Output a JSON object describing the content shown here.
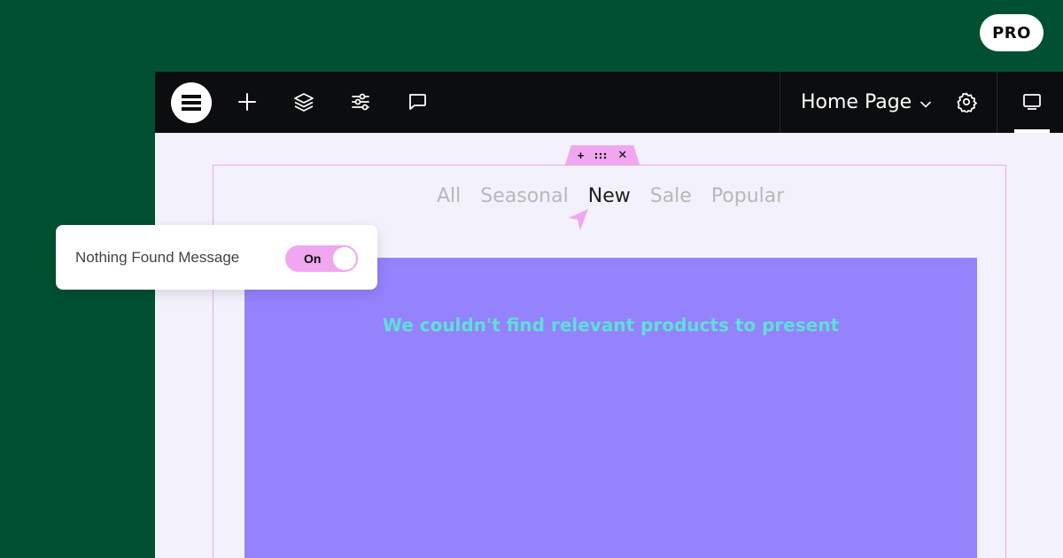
{
  "badge": {
    "label": "PRO"
  },
  "toolbar": {
    "icons": [
      "elementor-logo-icon",
      "plus-icon",
      "layers-icon",
      "sliders-icon",
      "comment-icon"
    ],
    "page_title": "Home Page",
    "settings_icon": "gear-icon",
    "device_icon": "desktop-icon"
  },
  "filter_tabs": {
    "items": [
      "All",
      "Seasonal",
      "New",
      "Sale",
      "Popular"
    ],
    "active": "New"
  },
  "results": {
    "nothing_found_text": "We couldn't find relevant products to present"
  },
  "popup": {
    "label": "Nothing Found Message",
    "toggle_label": "On",
    "toggle_state": true
  },
  "colors": {
    "background": "#005032",
    "toolbar": "#0c0d0e",
    "canvas": "#f3f1fb",
    "accent_pink": "#f0a7f0",
    "results_purple": "#9582fd",
    "message_teal": "#5ee0d5"
  }
}
